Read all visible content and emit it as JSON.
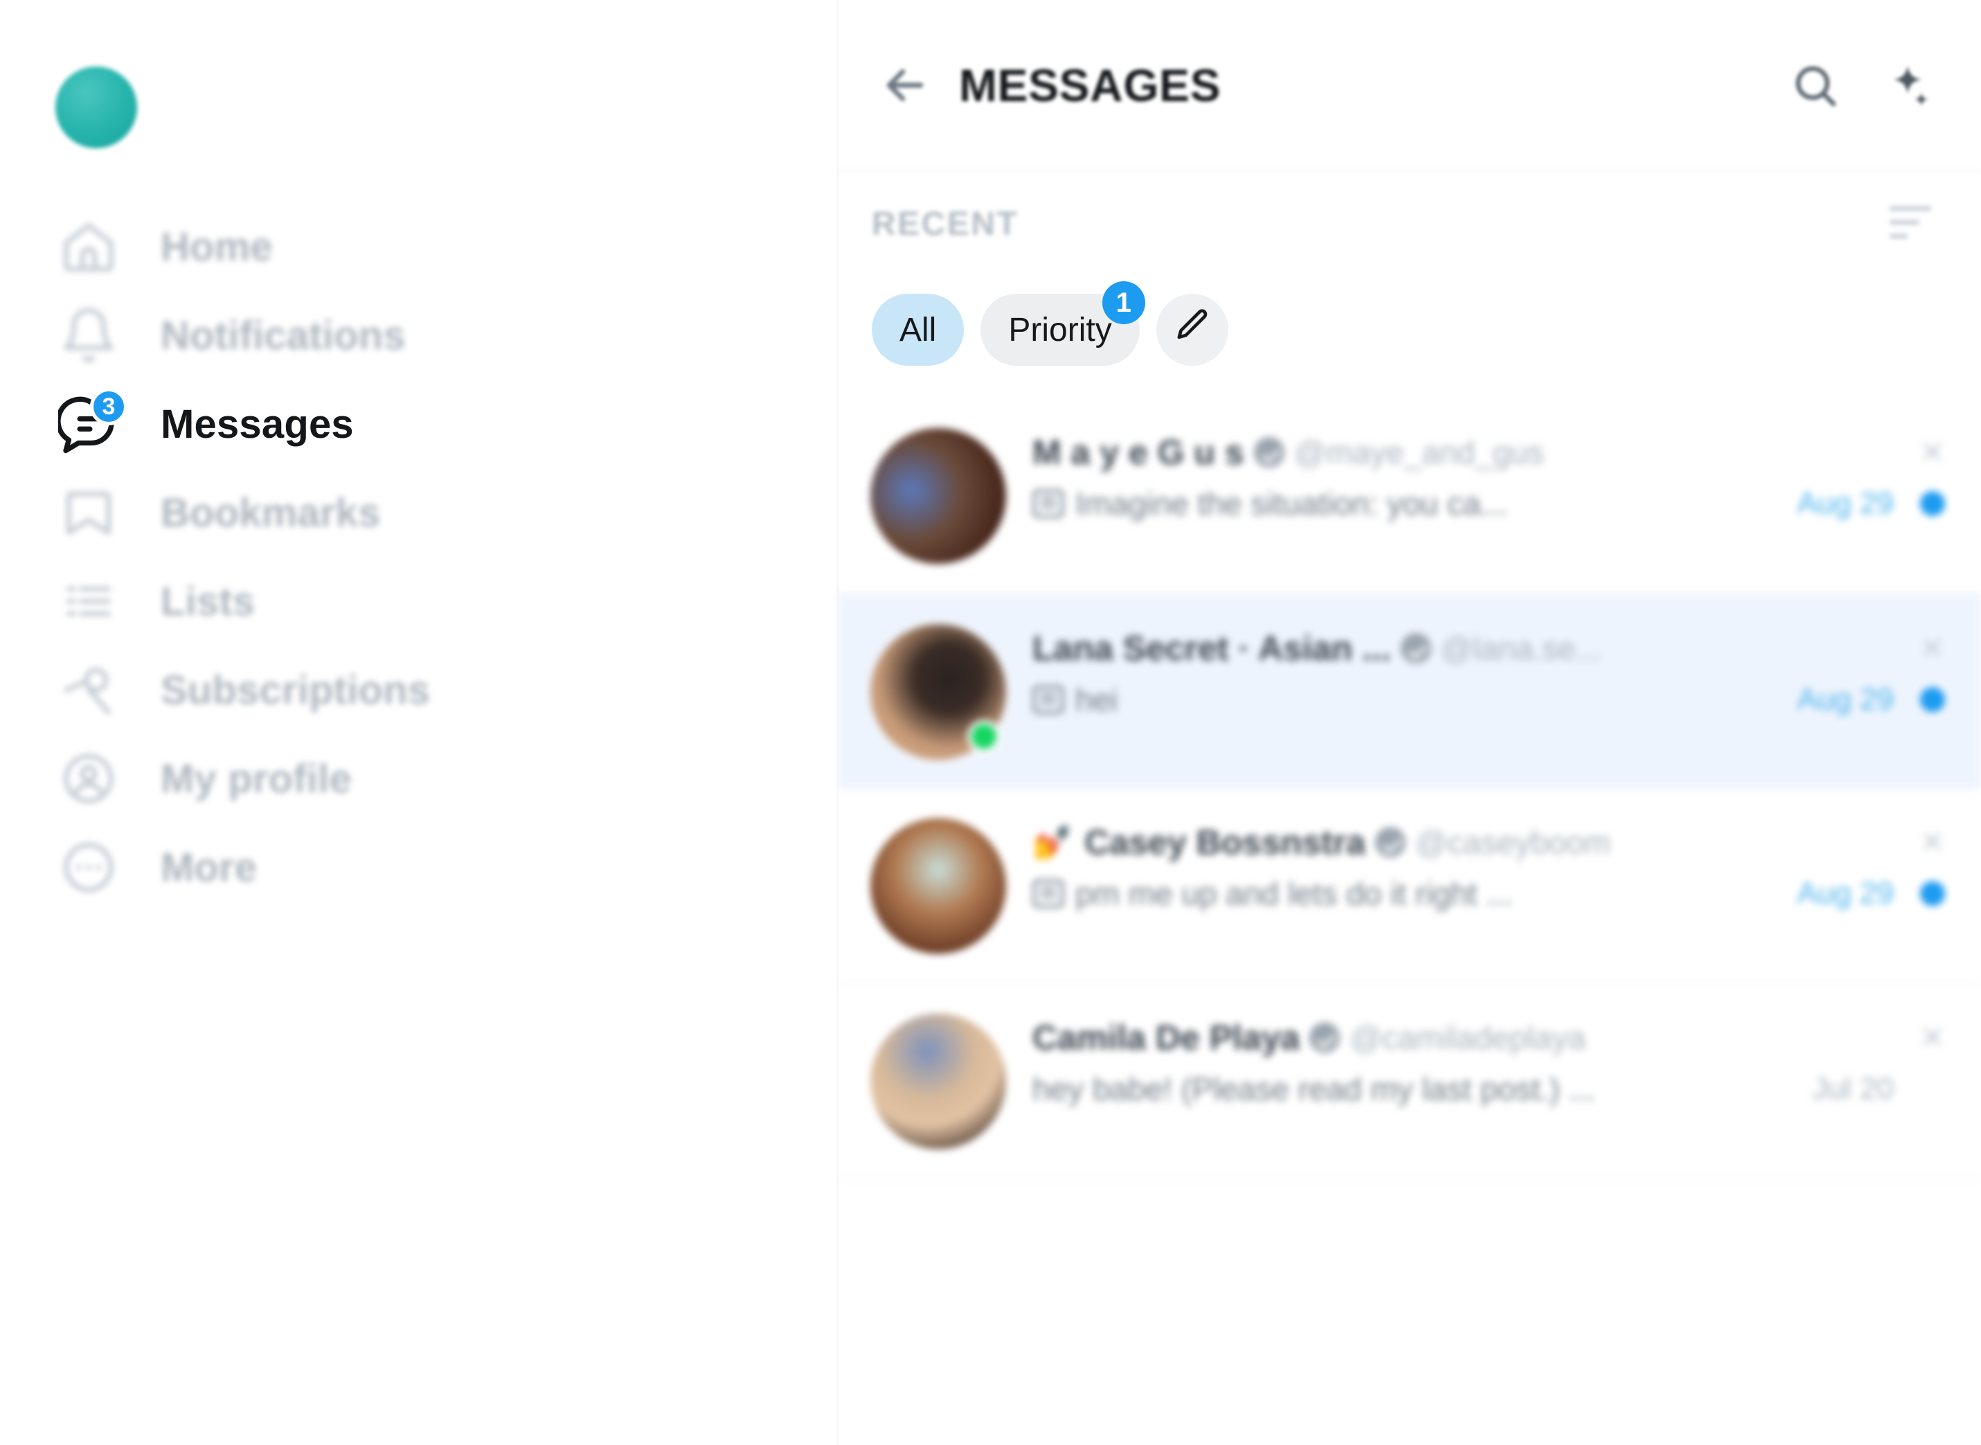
{
  "sidebar": {
    "logo_name": "brand-logo",
    "items": [
      {
        "label": "Home",
        "icon": "home-icon",
        "badge": null,
        "active": false
      },
      {
        "label": "Notifications",
        "icon": "bell-icon",
        "badge": null,
        "active": false
      },
      {
        "label": "Messages",
        "icon": "messages-icon",
        "badge": "3",
        "active": true
      },
      {
        "label": "Bookmarks",
        "icon": "bookmark-icon",
        "badge": null,
        "active": false
      },
      {
        "label": "Lists",
        "icon": "lists-icon",
        "badge": null,
        "active": false
      },
      {
        "label": "Subscriptions",
        "icon": "subscriptions-icon",
        "badge": null,
        "active": false
      },
      {
        "label": "My profile",
        "icon": "profile-icon",
        "badge": null,
        "active": false
      },
      {
        "label": "More",
        "icon": "more-icon",
        "badge": null,
        "active": false
      }
    ]
  },
  "header": {
    "title": "MESSAGES",
    "back_icon": "back-arrow-icon",
    "search_icon": "search-icon",
    "settings_icon": "sparkle-icon"
  },
  "recent": {
    "label": "RECENT",
    "sort_icon": "sort-icon"
  },
  "filters": {
    "all_label": "All",
    "priority_label": "Priority",
    "priority_badge": "1",
    "compose_icon": "pencil-icon"
  },
  "colors": {
    "accent_blue": "#1d9bf0",
    "chip_selected": "#c9e6f8",
    "chip_unselected": "#eceef0",
    "row_highlight": "#eef4fd",
    "online_green": "#16d663",
    "brand_teal": "#25b3ab"
  },
  "conversations": [
    {
      "name": "M a y e G u s",
      "verified": true,
      "handle": "@maye_and_gus",
      "emoji": "",
      "preview": "Imagine the situation: you ca...",
      "date": "Aug 29",
      "unread": true,
      "online": false,
      "highlighted": false,
      "close_icon": "close-icon"
    },
    {
      "name": "Lana Secret · Asian ...",
      "verified": true,
      "handle": "@lana.se...",
      "emoji": "",
      "preview": "hei",
      "date": "Aug 29",
      "unread": true,
      "online": true,
      "highlighted": true,
      "close_icon": "close-icon"
    },
    {
      "name": "Casey Bossnstra",
      "verified": true,
      "handle": "@caseyboom",
      "emoji": "💅",
      "preview": "pm me up and lets do it right ...",
      "date": "Aug 29",
      "unread": true,
      "online": false,
      "highlighted": false,
      "close_icon": "close-icon"
    },
    {
      "name": "Camila De Playa",
      "verified": true,
      "handle": "@camiladeplaya",
      "emoji": "",
      "preview": "hey babe! (Please read my last post.) ...",
      "date": "Jul 20",
      "unread": false,
      "online": false,
      "highlighted": false,
      "close_icon": "close-icon"
    }
  ]
}
